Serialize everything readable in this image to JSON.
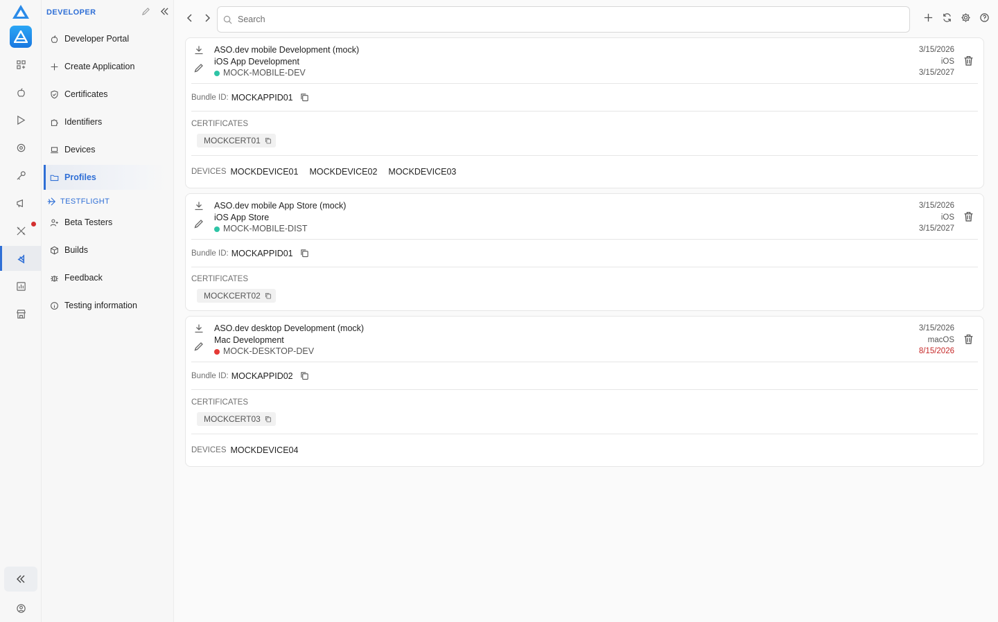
{
  "sidebar": {
    "section_developer": "DEVELOPER",
    "items_dev": [
      {
        "label": "Developer Portal",
        "icon": "apple-icon"
      },
      {
        "label": "Create Application",
        "icon": "plus-icon"
      },
      {
        "label": "Certificates",
        "icon": "shield-check-icon"
      },
      {
        "label": "Identifiers",
        "icon": "puzzle-icon"
      },
      {
        "label": "Devices",
        "icon": "laptop-icon"
      },
      {
        "label": "Profiles",
        "icon": "folder-icon"
      }
    ],
    "section_testflight": "TESTFLIGHT",
    "items_tf": [
      {
        "label": "Beta Testers",
        "icon": "user-plus-icon"
      },
      {
        "label": "Builds",
        "icon": "package-icon"
      },
      {
        "label": "Feedback",
        "icon": "bug-icon"
      },
      {
        "label": "Testing information",
        "icon": "info-icon"
      }
    ]
  },
  "search": {
    "placeholder": "Search"
  },
  "labels": {
    "bundle_prefix": "Bundle ID:",
    "certificates": "CERTIFICATES",
    "devices": "DEVICES"
  },
  "profiles": [
    {
      "name": "ASO.dev mobile Development (mock)",
      "type": "iOS App Development",
      "identifier": "MOCK-MOBILE-DEV",
      "status_color": "#2ec4a6",
      "created": "3/15/2026",
      "platform": "iOS",
      "expires": "3/15/2027",
      "bundle_id": "MOCKAPPID01",
      "certificates": [
        "MOCKCERT01"
      ],
      "devices": [
        "MOCKDEVICE01",
        "MOCKDEVICE02",
        "MOCKDEVICE03"
      ]
    },
    {
      "name": "ASO.dev mobile App Store (mock)",
      "type": "iOS App Store",
      "identifier": "MOCK-MOBILE-DIST",
      "status_color": "#2ec4a6",
      "created": "3/15/2026",
      "platform": "iOS",
      "expires": "3/15/2027",
      "bundle_id": "MOCKAPPID01",
      "certificates": [
        "MOCKCERT02"
      ],
      "devices": []
    },
    {
      "name": "ASO.dev desktop Development (mock)",
      "type": "Mac Development",
      "identifier": "MOCK-DESKTOP-DEV",
      "status_color": "#e53935",
      "created": "3/15/2026",
      "platform": "macOS",
      "expires": "8/15/2026",
      "expires_color": "#c62828",
      "bundle_id": "MOCKAPPID02",
      "certificates": [
        "MOCKCERT03"
      ],
      "devices": [
        "MOCKDEVICE04"
      ]
    }
  ],
  "colors": {
    "accent": "#2f6fd6",
    "alert": "#d32f2f"
  }
}
